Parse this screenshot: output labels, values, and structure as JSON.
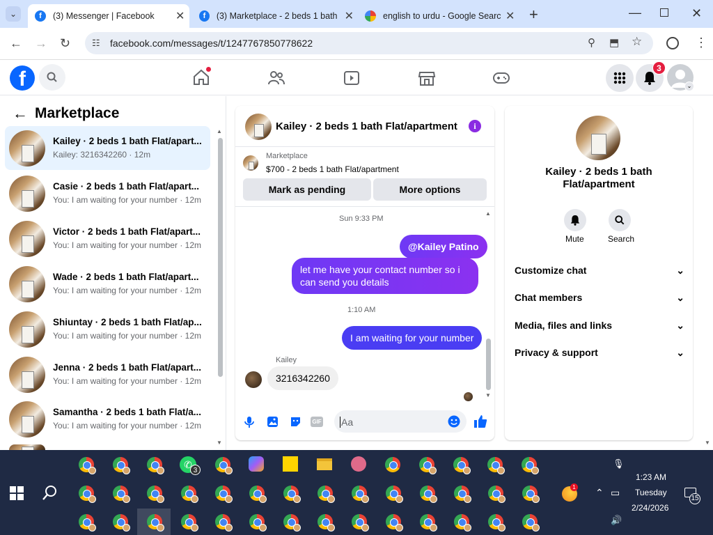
{
  "browser": {
    "tabs": [
      {
        "title": "(3) Messenger | Facebook"
      },
      {
        "title": "(3) Marketplace - 2 beds 1 bath"
      },
      {
        "title": "english to urdu - Google Search"
      }
    ],
    "url": "facebook.com/messages/t/1247767850778622"
  },
  "fb": {
    "logo_letter": "f",
    "notification_count": "3"
  },
  "sidebar": {
    "title": "Marketplace",
    "conversations": [
      {
        "name": "Kailey · 2 beds 1 bath Flat/apart...",
        "preview": "Kailey: 3216342260 · 12m"
      },
      {
        "name": "Casie · 2 beds 1 bath Flat/apart...",
        "preview": "You: I am waiting for your number · 12m"
      },
      {
        "name": "Victor · 2 beds 1 bath Flat/apart...",
        "preview": "You: I am waiting for your number · 12m"
      },
      {
        "name": "Wade · 2 beds 1 bath Flat/apart...",
        "preview": "You: I am waiting for your number · 12m"
      },
      {
        "name": "Shiuntay · 2 beds 1 bath Flat/ap...",
        "preview": "You: I am waiting for your number · 12m"
      },
      {
        "name": "Jenna · 2 beds 1 bath Flat/apart...",
        "preview": "You: I am waiting for your number · 12m"
      },
      {
        "name": "Samantha · 2 beds 1 bath Flat/a...",
        "preview": "You: I am waiting for your number · 12m"
      }
    ]
  },
  "chat": {
    "title": "Kailey · 2 beds 1 bath Flat/apartment",
    "listing_source": "Marketplace",
    "listing_title": "$700 - 2 beds 1 bath Flat/apartment",
    "mark_pending": "Mark as pending",
    "more_options": "More options",
    "messages": {
      "time1": "Sun 9:33 PM",
      "mention": "@Kailey Patino",
      "msg1": "let me have your contact number so i can send you details",
      "time2": "1:10 AM",
      "msg2": "I am waiting for your number",
      "sender": "Kailey",
      "reply": "3216342260"
    },
    "input_placeholder": "Aa"
  },
  "info": {
    "name": "Kailey · 2 beds 1 bath Flat/apartment",
    "mute": "Mute",
    "search": "Search",
    "sections": [
      "Customize chat",
      "Chat members",
      "Media, files and links",
      "Privacy & support"
    ]
  },
  "taskbar": {
    "whatsapp_badge": "3",
    "time": "1:23 AM",
    "day": "Tuesday",
    "date": "2/24/2026",
    "notif_count": "15",
    "tray_badge": "1"
  },
  "colors": {
    "fb_blue": "#0866ff",
    "bubble_purple": "#7b35f3",
    "taskbar": "#1f2a44"
  }
}
